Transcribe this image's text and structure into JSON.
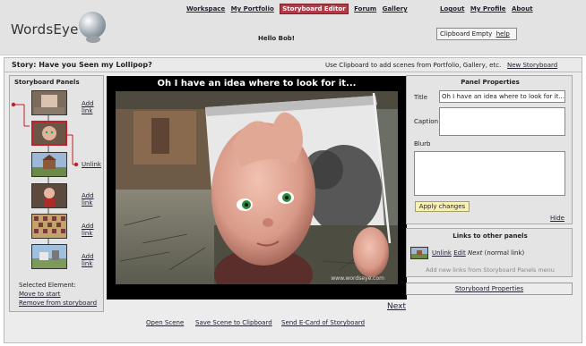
{
  "header": {
    "logo": "WordsEye",
    "nav": [
      "Workspace",
      "My Portfolio",
      "Storyboard Editor",
      "Forum",
      "Gallery"
    ],
    "user_nav": [
      "Logout",
      "My Profile",
      "About"
    ],
    "greeting": "Hello Bob!",
    "clipboard_status": "Clipboard Empty",
    "clipboard_help": "help"
  },
  "story": {
    "title": "Story: Have you Seen my Lollipop?",
    "hint": "Use Clipboard to add scenes from Portfolio, Gallery, etc.",
    "new_storyboard": "New Storyboard"
  },
  "storyboard_panels": {
    "title": "Storyboard Panels",
    "items": [
      {
        "link": "Add link"
      },
      {
        "link": ""
      },
      {
        "link": "Unlink"
      },
      {
        "link": "Add link"
      },
      {
        "link": "Add link"
      },
      {
        "link": "Add link"
      }
    ],
    "selected_element_label": "Selected Element:",
    "move_to_start": "Move to start",
    "remove": "Remove from storyboard"
  },
  "viewer": {
    "caption": "Oh I have an idea where to look for it...",
    "watermark": "www.wordseye.com",
    "next": "Next"
  },
  "bottom_links": [
    "Open Scene",
    "Save Scene to Clipboard",
    "Send E-Card of Storyboard"
  ],
  "panel_properties": {
    "title": "Panel Properties",
    "title_label": "Title",
    "title_value": "Oh I have an idea where to look for it...",
    "caption_label": "Caption",
    "caption_value": "",
    "blurb_label": "Blurb",
    "blurb_value": "",
    "apply": "Apply changes",
    "hide": "Hide"
  },
  "links_panel": {
    "title": "Links to other panels",
    "unlink": "Unlink",
    "edit": "Edit",
    "next": "Next",
    "type": "(normal link)",
    "add_hint": "Add new links from Storyboard Panels menu"
  },
  "storyboard_properties": "Storyboard Properties",
  "colors": {
    "active_nav": "#b23a46",
    "link_line": "#c0202a",
    "apply_button": "#f6f0b4"
  }
}
